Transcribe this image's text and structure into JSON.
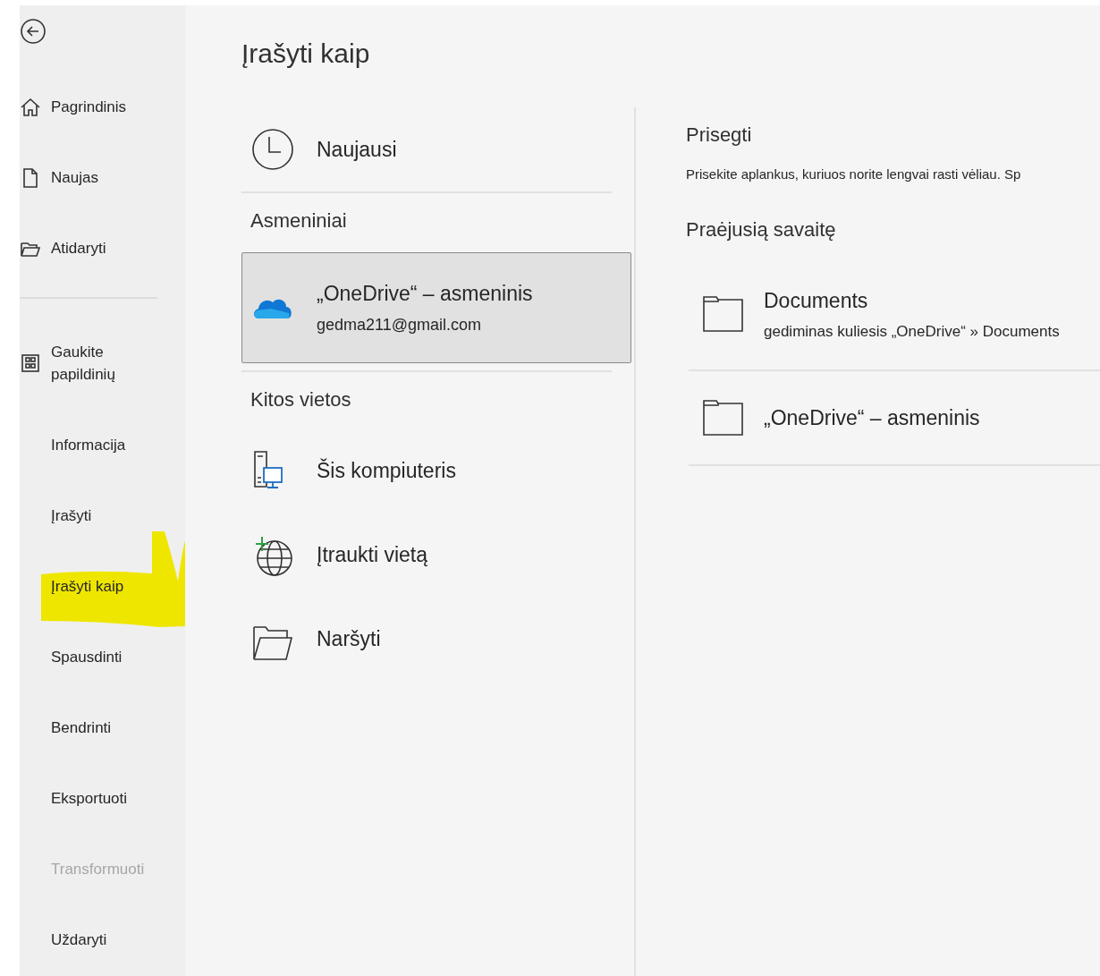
{
  "sidebar": {
    "groups": [
      {
        "items": [
          {
            "kind": "home",
            "label": "Pagrindinis",
            "disabled": false,
            "highlighted": false
          },
          {
            "kind": "document",
            "label": "Naujas",
            "disabled": false,
            "highlighted": false
          },
          {
            "kind": "folder",
            "label": "Atidaryti",
            "disabled": false,
            "highlighted": false
          }
        ]
      },
      {
        "items": [
          {
            "kind": "grid",
            "label": "Gaukite papildinių",
            "disabled": false,
            "highlighted": false
          },
          {
            "kind": "text",
            "label": "Informacija",
            "disabled": false,
            "highlighted": false
          },
          {
            "kind": "text",
            "label": "Įrašyti",
            "disabled": false,
            "highlighted": false
          },
          {
            "kind": "text",
            "label": "Įrašyti kaip",
            "disabled": false,
            "highlighted": true
          },
          {
            "kind": "text",
            "label": "Spausdinti",
            "disabled": false,
            "highlighted": false
          },
          {
            "kind": "text",
            "label": "Bendrinti",
            "disabled": false,
            "highlighted": false
          },
          {
            "kind": "text",
            "label": "Eksportuoti",
            "disabled": false,
            "highlighted": false
          },
          {
            "kind": "text",
            "label": "Transformuoti",
            "disabled": true,
            "highlighted": false
          },
          {
            "kind": "text",
            "label": "Uždaryti",
            "disabled": false,
            "highlighted": false
          }
        ]
      }
    ]
  },
  "title": "Įrašyti kaip",
  "locations": {
    "recent": {
      "kind": "clock",
      "label": "Naujausi",
      "selected": false
    },
    "sections": [
      {
        "heading": "Asmeniniai",
        "items": [
          {
            "kind": "onedrive",
            "label": "„OneDrive“ – asmeninis",
            "sublabel": "gedma211@gmail.com",
            "selected": true
          }
        ]
      },
      {
        "heading": "Kitos vietos",
        "items": [
          {
            "kind": "computer",
            "label": "Šis kompiuteris",
            "selected": false
          },
          {
            "kind": "globe",
            "label": "Įtraukti vietą",
            "selected": false
          },
          {
            "kind": "folder",
            "label": "Naršyti",
            "selected": false
          }
        ]
      }
    ]
  },
  "pinned": {
    "heading": "Prisegti",
    "hint": "Prisekite aplankus, kuriuos norite lengvai rasti vėliau. Sp"
  },
  "recent_groups": [
    {
      "heading": "Praėjusią savaitę",
      "folders": [
        {
          "name": "Documents",
          "path": "gediminas kuliesis „OneDrive“ » Documents"
        },
        {
          "name": "„OneDrive“ – asmeninis"
        }
      ]
    }
  ]
}
